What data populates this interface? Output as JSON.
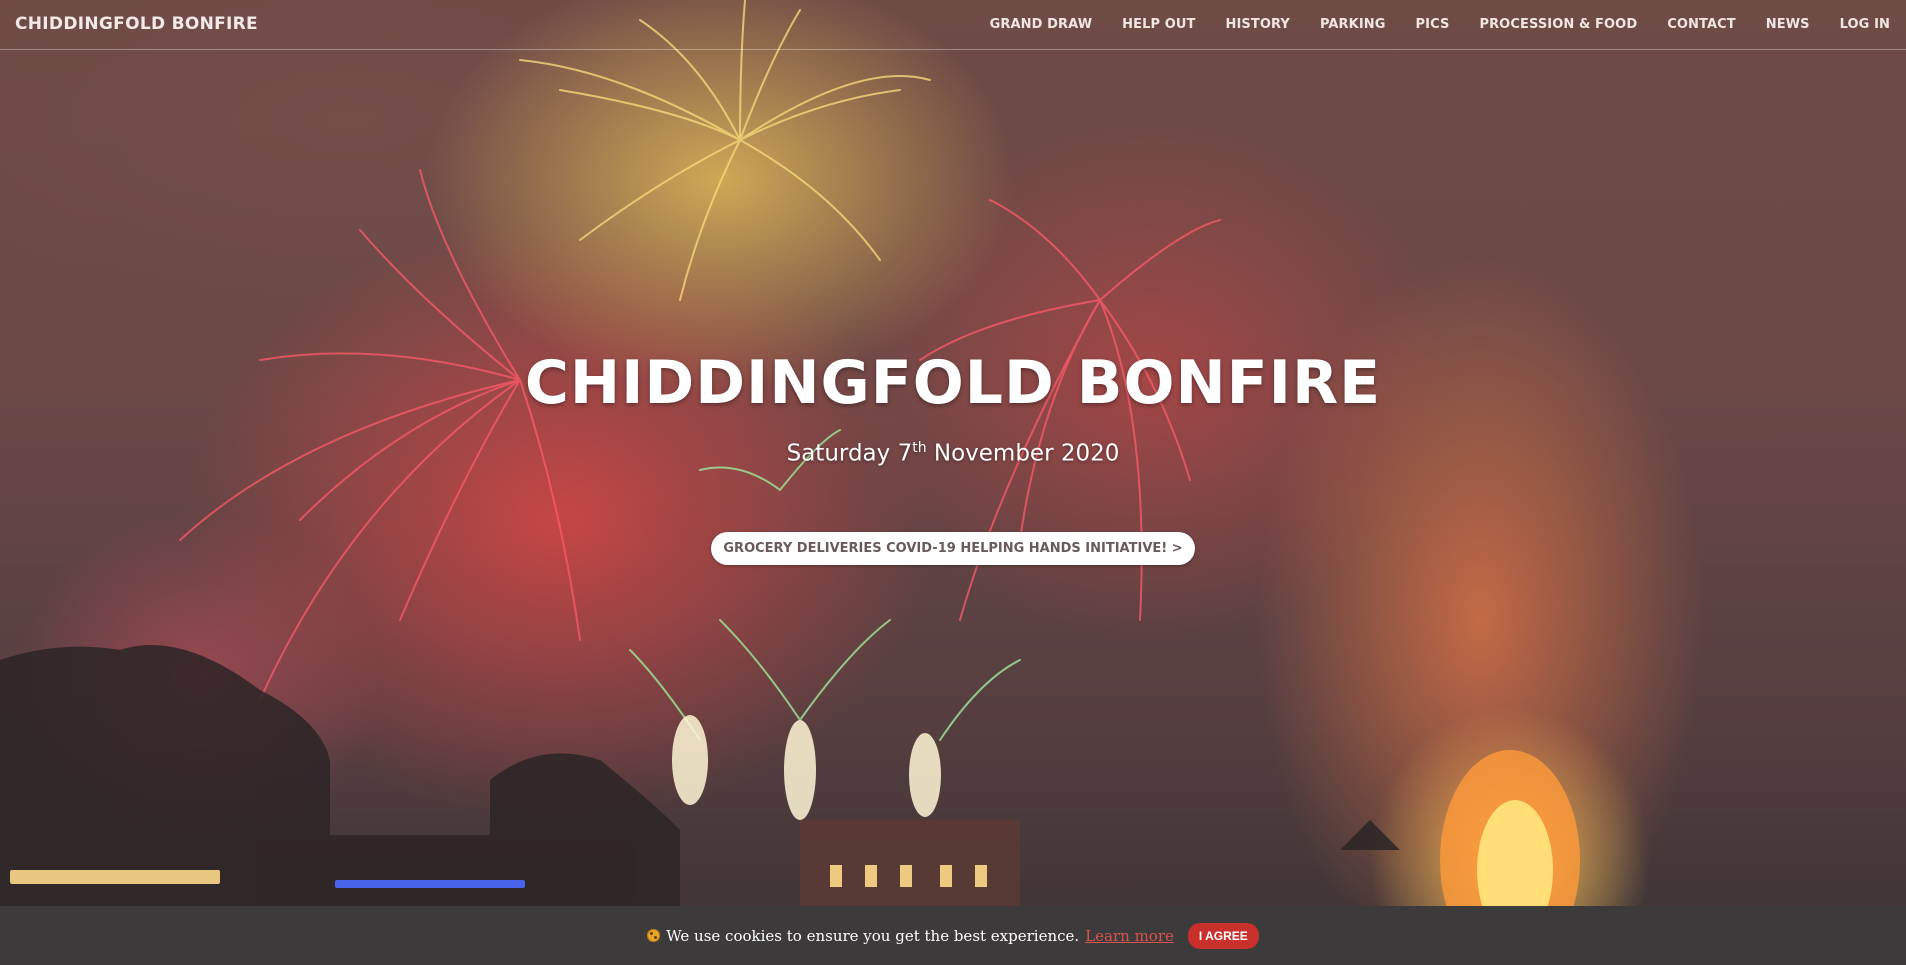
{
  "nav": {
    "brand": "CHIDDINGFOLD BONFIRE",
    "items": [
      {
        "label": "GRAND DRAW"
      },
      {
        "label": "HELP OUT"
      },
      {
        "label": "HISTORY"
      },
      {
        "label": "PARKING"
      },
      {
        "label": "PICS"
      },
      {
        "label": "PROCESSION & FOOD"
      },
      {
        "label": "CONTACT"
      },
      {
        "label": "NEWS"
      },
      {
        "label": "LOG IN"
      }
    ]
  },
  "hero": {
    "title": "CHIDDINGFOLD BONFIRE",
    "date_prefix": "Saturday 7",
    "date_suffix": "th",
    "date_rest": " November 2020",
    "cta_label": "GROCERY DELIVERIES COVID-19 HELPING HANDS INITIATIVE! >"
  },
  "cookie": {
    "icon": "cookie-icon",
    "message": "We use cookies to ensure you get the best experience.",
    "learn_more": "Learn more",
    "agree": "I AGREE"
  },
  "colors": {
    "accent": "#c9302c",
    "link": "#d9534f",
    "bar": "#3d3a3b"
  }
}
